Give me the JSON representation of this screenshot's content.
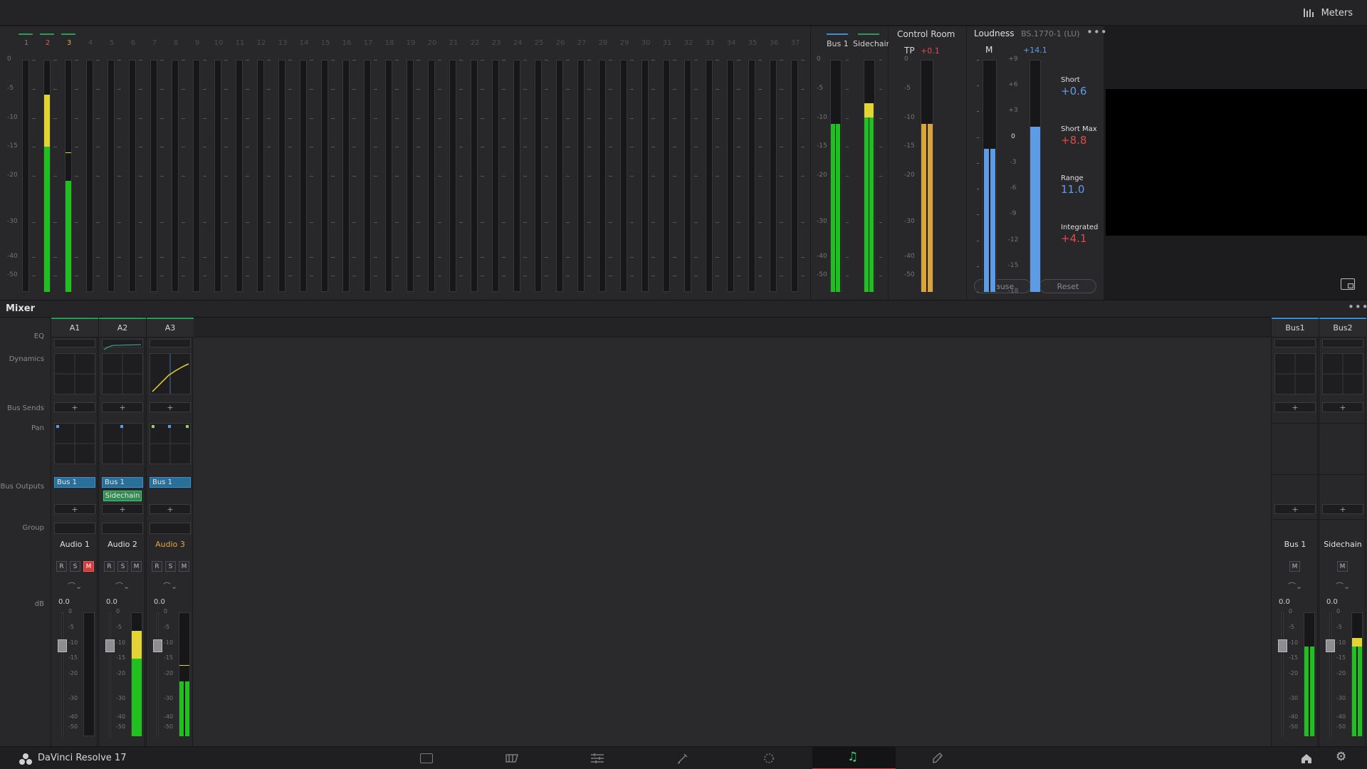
{
  "topbar": {
    "meters_label": "Meters",
    "meters_icon": "meters-icon"
  },
  "track_meters": {
    "channels": [
      "1",
      "2",
      "3",
      "4",
      "5",
      "6",
      "7",
      "8",
      "9",
      "10",
      "11",
      "12",
      "13",
      "14",
      "15",
      "16",
      "17",
      "18",
      "19",
      "20",
      "21",
      "22",
      "23",
      "24",
      "25",
      "26",
      "27",
      "28",
      "29",
      "30",
      "31",
      "32",
      "33",
      "34",
      "35",
      "36",
      "37"
    ],
    "scale": [
      "0",
      "-5",
      "-10",
      "-15",
      "-20",
      "-30",
      "-40",
      "-50"
    ],
    "active_levels": [
      {
        "channel": "2",
        "level_db": -6,
        "peak_db": -6
      },
      {
        "channel": "3",
        "level_db": -21,
        "peak_db": -16
      }
    ]
  },
  "bus_meters": {
    "labels": [
      "Bus 1",
      "Sidechain"
    ],
    "levels_db": [
      -11,
      -10
    ]
  },
  "control_room": {
    "title": "Control Room",
    "tp_label": "TP",
    "tp_value": "+0.1",
    "scale": [
      "0",
      "-5",
      "-10",
      "-15",
      "-20",
      "-30",
      "-40",
      "-50"
    ],
    "level_db": -11
  },
  "loudness": {
    "title": "Loudness",
    "standard": "BS.1770-1 (LU)",
    "m_label": "M",
    "m_value": "+14.1",
    "scale": [
      "+9",
      "+6",
      "+3",
      "0",
      "-3",
      "-6",
      "-9",
      "-12",
      "-15",
      "-18"
    ],
    "readouts": [
      {
        "label": "Short",
        "value": "+0.6",
        "color": "#5c9ce6"
      },
      {
        "label": "Short Max",
        "value": "+8.8",
        "color": "#e24a4a"
      },
      {
        "label": "Range",
        "value": "11.0",
        "color": "#5c9ce6"
      },
      {
        "label": "Integrated",
        "value": "+4.1",
        "color": "#e24a4a"
      }
    ],
    "pause_label": "Pause",
    "reset_label": "Reset"
  },
  "mixer": {
    "title": "Mixer",
    "row_labels": {
      "eq": "EQ",
      "dynamics": "Dynamics",
      "bus_sends": "Bus Sends",
      "pan": "Pan",
      "bus_outputs": "Bus Outputs",
      "group": "Group",
      "db": "dB"
    },
    "channels": [
      {
        "id": "A1",
        "name": "Audio 1",
        "outputs": [
          "Bus 1"
        ],
        "level": "0.0",
        "muted": true
      },
      {
        "id": "A2",
        "name": "Audio 2",
        "outputs": [
          "Bus 1",
          "Sidechain"
        ],
        "level": "0.0",
        "muted": false
      },
      {
        "id": "A3",
        "name": "Audio 3",
        "outputs": [
          "Bus 1"
        ],
        "level": "0.0",
        "muted": false
      }
    ],
    "buses": [
      {
        "id": "Bus1",
        "name": "Bus 1",
        "level": "0.0"
      },
      {
        "id": "Bus2",
        "name": "Sidechain",
        "level": "0.0"
      }
    ],
    "rsm": {
      "r": "R",
      "s": "S",
      "m": "M"
    },
    "fader_scale": [
      "0",
      "-5",
      "-10",
      "-15",
      "-20",
      "-30",
      "-40",
      "-50"
    ],
    "plus": "+"
  },
  "bottombar": {
    "app_name": "DaVinci Resolve 17"
  },
  "colors": {
    "green": "#21c021",
    "yellow": "#e3d531",
    "red": "#d82d2d",
    "blue": "#5c9ce6",
    "amber": "#d9a43a",
    "accent_teal": "#3fb8a6"
  }
}
